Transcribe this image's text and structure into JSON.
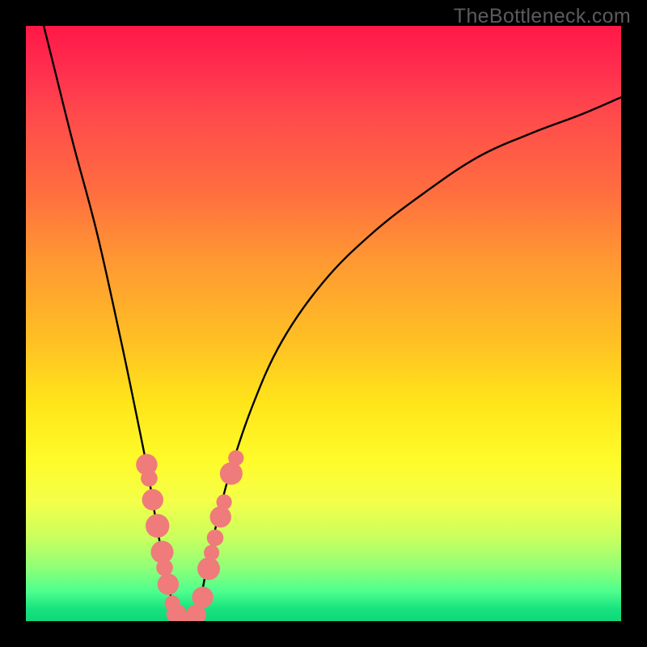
{
  "watermark": "TheBottleneck.com",
  "chart_data": {
    "type": "line",
    "title": "",
    "xlabel": "",
    "ylabel": "",
    "xlim": [
      0,
      100
    ],
    "ylim": [
      0,
      100
    ],
    "grid": false,
    "legend": false,
    "series": [
      {
        "name": "bottleneck-curve",
        "color": "#000000",
        "x": [
          3,
          5,
          8,
          12,
          16,
          18.5,
          20.5,
          22,
          23.5,
          25,
          26.5,
          28,
          29,
          30,
          31,
          34,
          38,
          43,
          50,
          58,
          67,
          76,
          85,
          93,
          100
        ],
        "y": [
          100,
          92,
          80,
          65,
          47,
          35,
          25,
          16,
          8,
          2,
          0,
          0,
          2,
          7,
          12,
          24,
          36,
          47,
          57,
          65,
          72,
          78,
          82,
          85,
          88
        ]
      }
    ],
    "markers": [
      {
        "name": "data-point",
        "x": 20.3,
        "y": 26.3,
        "r": 1.8
      },
      {
        "name": "data-point",
        "x": 20.7,
        "y": 24.0,
        "r": 1.4
      },
      {
        "name": "data-point",
        "x": 21.3,
        "y": 20.4,
        "r": 1.8
      },
      {
        "name": "data-point",
        "x": 22.1,
        "y": 16.0,
        "r": 2.0
      },
      {
        "name": "data-point",
        "x": 22.9,
        "y": 11.6,
        "r": 1.9
      },
      {
        "name": "data-point",
        "x": 23.3,
        "y": 9.0,
        "r": 1.4
      },
      {
        "name": "data-point",
        "x": 23.9,
        "y": 6.2,
        "r": 1.8
      },
      {
        "name": "data-point",
        "x": 24.6,
        "y": 3.0,
        "r": 1.3
      },
      {
        "name": "data-point",
        "x": 25.3,
        "y": 1.2,
        "r": 1.7
      },
      {
        "name": "data-point",
        "x": 26.4,
        "y": 0.2,
        "r": 1.6
      },
      {
        "name": "data-point",
        "x": 27.5,
        "y": 0.1,
        "r": 1.6
      },
      {
        "name": "data-point",
        "x": 28.6,
        "y": 1.1,
        "r": 1.7
      },
      {
        "name": "data-point",
        "x": 29.7,
        "y": 4.0,
        "r": 1.8
      },
      {
        "name": "data-point",
        "x": 30.7,
        "y": 8.8,
        "r": 1.9
      },
      {
        "name": "data-point",
        "x": 31.2,
        "y": 11.5,
        "r": 1.3
      },
      {
        "name": "data-point",
        "x": 31.8,
        "y": 14.0,
        "r": 1.4
      },
      {
        "name": "data-point",
        "x": 32.7,
        "y": 17.5,
        "r": 1.8
      },
      {
        "name": "data-point",
        "x": 33.3,
        "y": 20.0,
        "r": 1.3
      },
      {
        "name": "data-point",
        "x": 34.5,
        "y": 24.8,
        "r": 1.9
      },
      {
        "name": "data-point",
        "x": 35.3,
        "y": 27.4,
        "r": 1.3
      }
    ],
    "marker_color": "#ef7b7b"
  }
}
